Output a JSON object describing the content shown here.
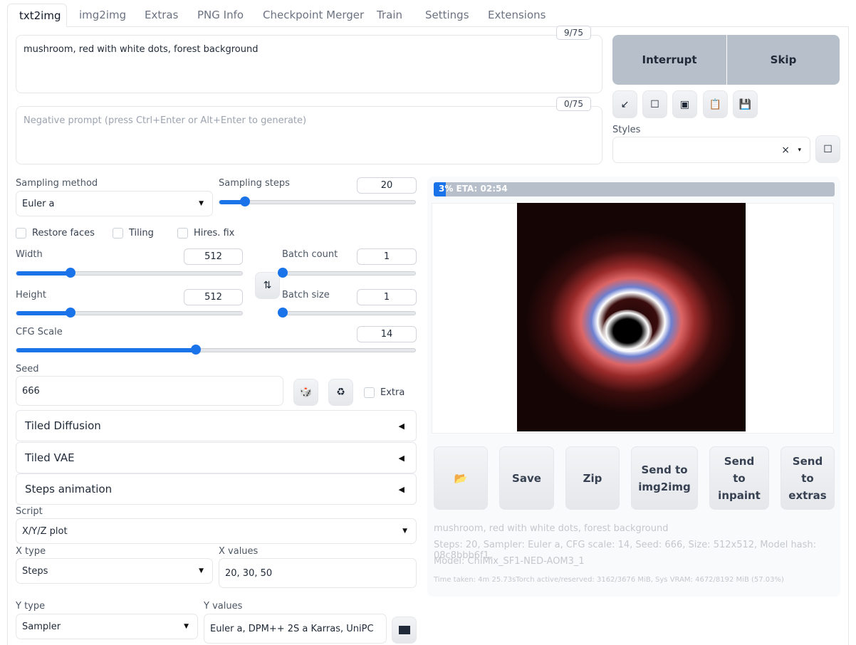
{
  "tabs": [
    "txt2img",
    "img2img",
    "Extras",
    "PNG Info",
    "Checkpoint Merger",
    "Train",
    "Settings",
    "Extensions"
  ],
  "prompt": {
    "value": "mushroom, red with white dots, forest background",
    "counter": "9/75"
  },
  "negative_prompt": {
    "placeholder": "Negative prompt (press Ctrl+Enter or Alt+Enter to generate)",
    "counter": "0/75"
  },
  "actions": {
    "interrupt": "Interrupt",
    "skip": "Skip"
  },
  "tools": [
    {
      "icon": "arrow-icon",
      "glyph": "↙"
    },
    {
      "icon": "square-icon",
      "glyph": "☐"
    },
    {
      "icon": "image-icon",
      "glyph": "▣"
    },
    {
      "icon": "clipboard-icon",
      "glyph": "📋"
    },
    {
      "icon": "save-icon",
      "glyph": "💾"
    }
  ],
  "styles": {
    "label": "Styles",
    "clear": "×",
    "caret": "▾",
    "button_glyph": "☐"
  },
  "sampling": {
    "method_label": "Sampling method",
    "method": "Euler a",
    "steps_label": "Sampling steps",
    "steps": "20",
    "steps_fraction": 0.13
  },
  "checkboxes": [
    "Restore faces",
    "Tiling",
    "Hires. fix"
  ],
  "width": {
    "label": "Width",
    "value": "512",
    "fraction": 0.24
  },
  "height": {
    "label": "Height",
    "value": "512",
    "fraction": 0.24
  },
  "swap_glyph": "⇅",
  "batch_count": {
    "label": "Batch count",
    "value": "1",
    "fraction": 0
  },
  "batch_size": {
    "label": "Batch size",
    "value": "1",
    "fraction": 0
  },
  "cfg": {
    "label": "CFG Scale",
    "value": "14",
    "fraction": 0.45
  },
  "seed": {
    "label": "Seed",
    "value": "666",
    "extra": "Extra",
    "dice_glyph": "🎲",
    "recycle_glyph": "♻"
  },
  "accordions": [
    "Tiled Diffusion",
    "Tiled VAE",
    "Steps animation"
  ],
  "accordion_arrow": "◀",
  "script": {
    "label": "Script",
    "value": "X/Y/Z plot"
  },
  "xyz": {
    "x_type_label": "X type",
    "x_type": "Steps",
    "x_values_label": "X values",
    "x_values": "20, 30, 50",
    "y_type_label": "Y type",
    "y_type": "Sampler",
    "y_values_label": "Y values",
    "y_values": "Euler a, DPM++ 2S a Karras, UniPC"
  },
  "progress": {
    "text": "3% ETA: 02:54",
    "fraction": 0.03
  },
  "output_buttons": {
    "folder": "📂",
    "save": "Save",
    "zip": "Zip",
    "img2img": "Send to img2img",
    "inpaint": "Send to inpaint",
    "extras": "Send to extras"
  },
  "info": {
    "prompt": "mushroom, red with white dots, forest background",
    "params": "Steps: 20, Sampler: Euler a, CFG scale: 14, Seed: 666, Size: 512x512, Model hash: 08c8bbb6f1,",
    "model": "Model: ChiMix_SF1-NED-AOM3_1",
    "time": "Time taken: 4m 25.73sTorch active/reserved: 3162/3676 MiB, Sys VRAM: 4672/8192 MiB (57.03%)"
  }
}
